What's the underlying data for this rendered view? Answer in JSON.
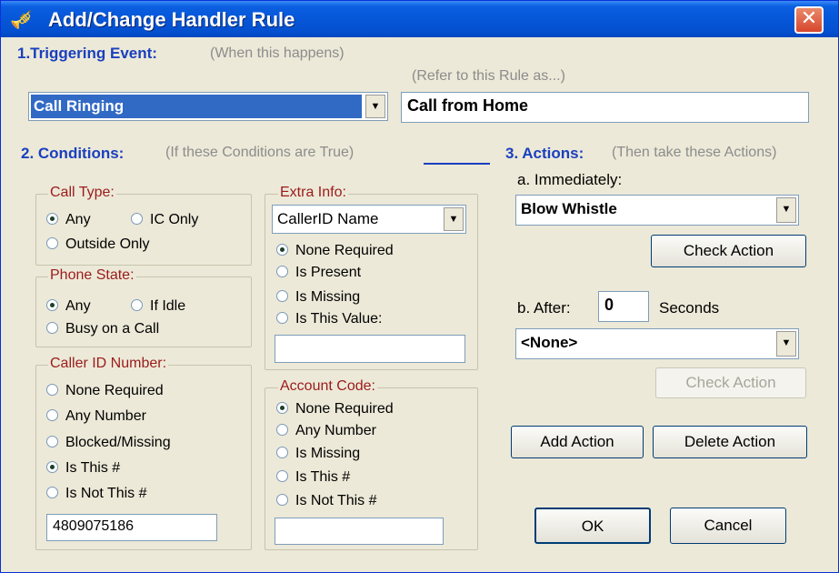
{
  "window": {
    "title": "Add/Change Handler Rule"
  },
  "section1": {
    "heading": "1.Triggering Event:",
    "hint": "(When this happens)",
    "name_hint": "(Refer to this Rule as...)",
    "event_value": "Call Ringing",
    "rule_name": "Call from Home"
  },
  "section2": {
    "heading": "2. Conditions:",
    "hint": "(If these Conditions are True)",
    "call_type": {
      "title": "Call Type:",
      "options": [
        "Any",
        "IC Only",
        "Outside Only"
      ],
      "selected": "Any"
    },
    "phone_state": {
      "title": "Phone State:",
      "options": [
        "Any",
        "If Idle",
        "Busy on a Call"
      ],
      "selected": "Any"
    },
    "caller_id": {
      "title": "Caller ID Number:",
      "options": [
        "None Required",
        "Any Number",
        "Blocked/Missing",
        "Is This #",
        "Is Not This #"
      ],
      "selected": "Is This #",
      "value": "4809075186"
    },
    "extra_info": {
      "title": "Extra Info:",
      "field": "CallerID Name",
      "options": [
        "None Required",
        "Is Present",
        "Is Missing",
        "Is This Value:"
      ],
      "selected": "None Required",
      "value": ""
    },
    "account_code": {
      "title": "Account Code:",
      "options": [
        "None Required",
        "Any Number",
        "Is Missing",
        "Is This #",
        "Is Not This #"
      ],
      "selected": "None Required",
      "value": ""
    }
  },
  "section3": {
    "heading": "3. Actions:",
    "hint": "(Then take these Actions)",
    "immediately_label": "a. Immediately:",
    "immediate_action": "Blow Whistle",
    "check_action_label": "Check Action",
    "after_label": "b. After:",
    "after_seconds": "0",
    "seconds_label": "Seconds",
    "after_action": "<None>",
    "check_action2_label": "Check Action",
    "add_action_label": "Add Action",
    "delete_action_label": "Delete Action"
  },
  "buttons": {
    "ok": "OK",
    "cancel": "Cancel"
  }
}
